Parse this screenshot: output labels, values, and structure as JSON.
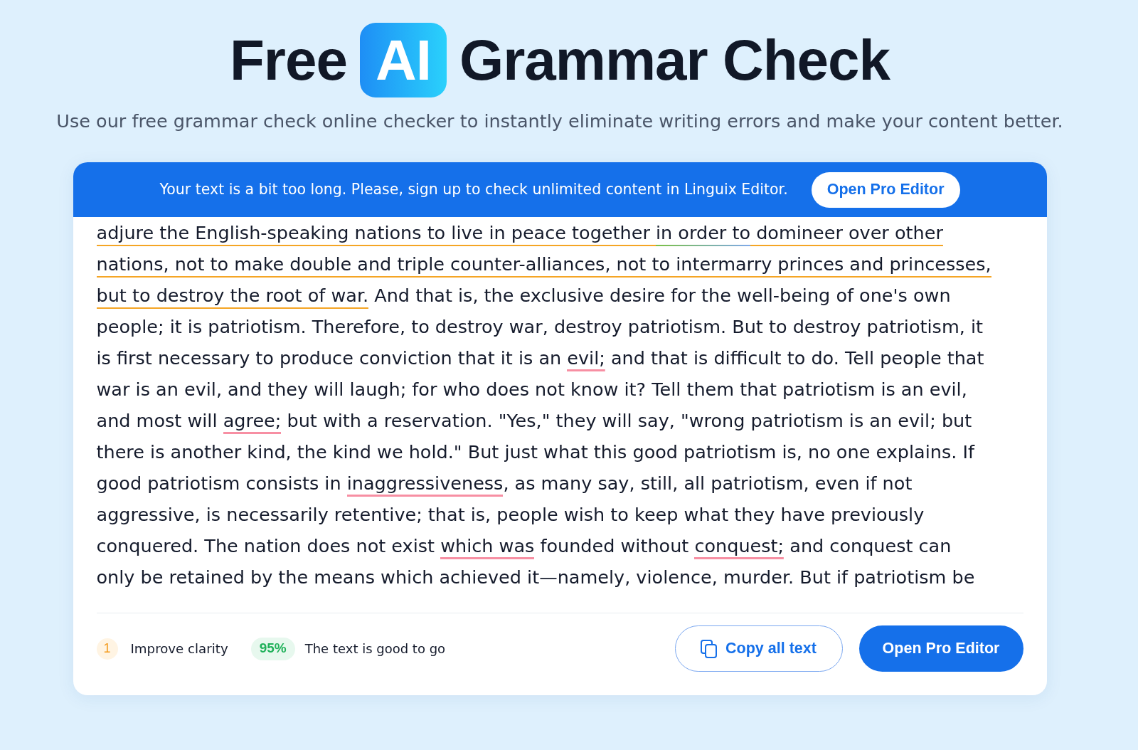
{
  "header": {
    "title_parts": [
      {
        "text": "Free",
        "kind": "plain"
      },
      {
        "text": "AI",
        "kind": "badge"
      },
      {
        "text": "Grammar Check",
        "kind": "plain"
      }
    ],
    "subtitle": "Use our free grammar check online checker to instantly eliminate writing errors and make your content better."
  },
  "checker": {
    "notice": {
      "text": "Your text is a bit too long. Please, sign up to check unlimited content in Linguix Editor.",
      "button": "Open Pro Editor"
    },
    "document": {
      "segments": [
        {
          "text": "adjure the English-speaking nations to live in peace together ",
          "kind": "clarity"
        },
        {
          "text": "in order to",
          "kind": "conciseness"
        },
        {
          "text": " domineer over other nations, not to make double and triple counter-alliances, not to intermarry princes and princesses, but to destroy the root of war.",
          "kind": "clarity"
        },
        {
          "text": " And that is, the exclusive desire for the well-being of one's own people; it is patriotism. Therefore, to destroy war, destroy patriotism. But to destroy patriotism, it is first necessary to produce conviction that it is an ",
          "kind": "plain"
        },
        {
          "text": "evil;",
          "kind": "correctness"
        },
        {
          "text": " and that is difficult to do. Tell people that war is an evil, and they will laugh; for who does not know it? Tell them that patriotism is an evil, and most will ",
          "kind": "plain"
        },
        {
          "text": "agree;",
          "kind": "correctness"
        },
        {
          "text": " but with a reservation. \"Yes,\" they will say, \"wrong patriotism is an evil; but there is another kind, the kind we hold.\" But just what this good patriotism is, no one explains. If good patriotism consists in ",
          "kind": "plain"
        },
        {
          "text": "inaggressiveness",
          "kind": "correctness"
        },
        {
          "text": ", as many say, still, all patriotism, even if not aggressive, is necessarily retentive; that is, people wish to keep what they have previously conquered. The nation does not exist ",
          "kind": "plain"
        },
        {
          "text": "which was",
          "kind": "correctness"
        },
        {
          "text": " founded without ",
          "kind": "plain"
        },
        {
          "text": "conquest;",
          "kind": "correctness"
        },
        {
          "text": " and conquest can only be retained by the means which achieved it—namely, violence, murder. But if patriotism be",
          "kind": "plain"
        }
      ]
    },
    "footer": {
      "issues": [
        {
          "count": "1",
          "label": "Improve clarity"
        }
      ],
      "score": {
        "value": "95%",
        "label": "The text is good to go"
      },
      "buttons": [
        {
          "label": "Copy all text",
          "kind": "outline"
        },
        {
          "label": "Open Pro Editor",
          "kind": "primary"
        }
      ]
    }
  }
}
